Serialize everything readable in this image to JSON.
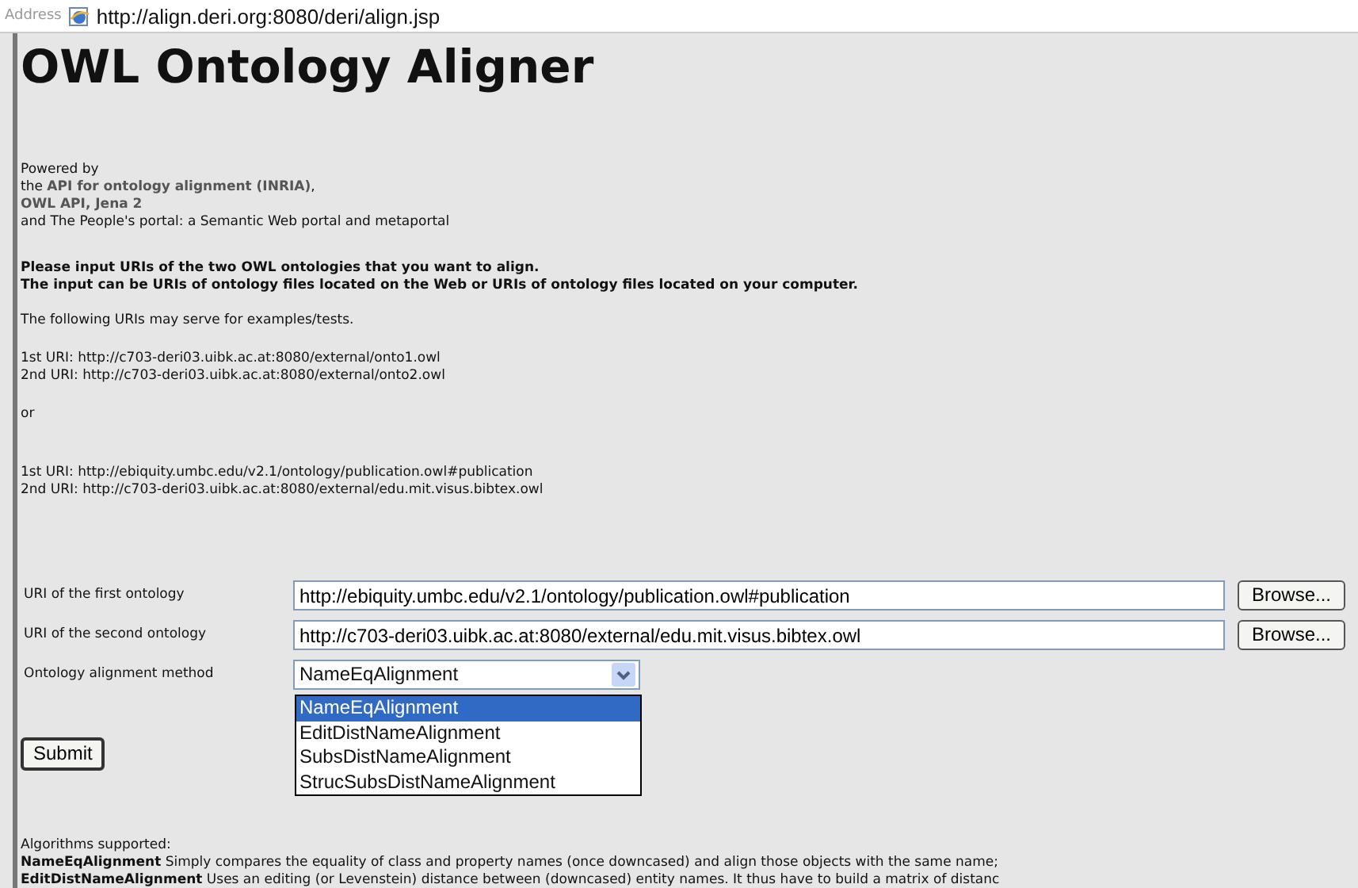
{
  "address_bar": {
    "label": "Address",
    "url": "http://align.deri.org:8080/deri/align.jsp"
  },
  "title": "OWL Ontology Aligner",
  "powered_by": [
    "Powered by",
    "the **API for ontology alignment (INRIA)**,",
    "**OWL API, Jena 2**",
    "and The People's portal: a Semantic Web portal and metaportal"
  ],
  "instructions": [
    "Please input URIs of the two OWL ontologies that you want to align.",
    "The input can be URIs of ontology files located on the Web or URIs of ontology files located on your computer."
  ],
  "examples_intro": "The following URIs may serve for examples/tests.",
  "example_sets": [
    {
      "lines": [
        "1st URI: http://c703-deri03.uibk.ac.at:8080/external/onto1.owl",
        "2nd URI: http://c703-deri03.uibk.ac.at:8080/external/onto2.owl"
      ]
    },
    {
      "separator": "or",
      "lines": [
        "1st URI: http://ebiquity.umbc.edu/v2.1/ontology/publication.owl#publication",
        "2nd URI: http://c703-deri03.uibk.ac.at:8080/external/edu.mit.visus.bibtex.owl"
      ]
    }
  ],
  "form": {
    "fields": [
      {
        "label": "URI of the first ontology",
        "value": "http://ebiquity.umbc.edu/v2.1/ontology/publication.owl#publication",
        "browse": "Browse..."
      },
      {
        "label": "URI of the second ontology",
        "value": "http://c703-deri03.uibk.ac.at:8080/external/edu.mit.visus.bibtex.owl",
        "browse": "Browse..."
      }
    ],
    "method": {
      "label": "Ontology alignment method",
      "value": "NameEqAlignment",
      "expanded": true,
      "options": [
        {
          "label": "NameEqAlignment",
          "selected": true
        },
        {
          "label": "EditDistNameAlignment",
          "selected": false
        },
        {
          "label": "SubsDistNameAlignment",
          "selected": false
        },
        {
          "label": "StrucSubsDistNameAlignment",
          "selected": false
        }
      ]
    },
    "submit": "Submit"
  },
  "algorithms": {
    "heading": "Algorithms supported:",
    "items": [
      {
        "name": "NameEqAlignment",
        "description": " Simply compares the equality of class and property names (once downcased) and align those objects with the same name;"
      },
      {
        "name": "EditDistNameAlignment",
        "description": " Uses an editing (or Levenstein) distance between (downcased) entity names. It thus have to build a matrix of distanc"
      }
    ]
  }
}
